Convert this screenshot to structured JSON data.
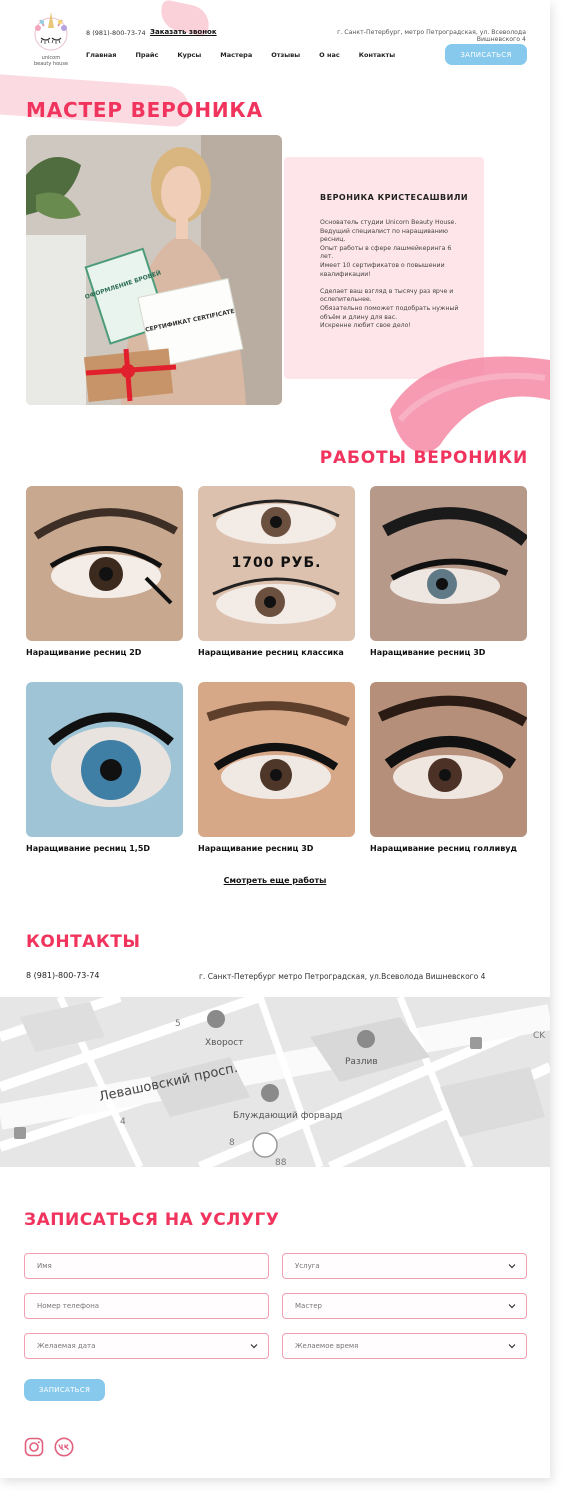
{
  "header": {
    "logo_text": "unicorn beauty house",
    "phone": "8 (981)-800-73-74",
    "callback_label": "Заказать звонок",
    "address": "г. Санкт-Петербург, метро Петроградская, ул. Всеволода Вишневского 4",
    "nav": [
      "Главная",
      "Прайс",
      "Курсы",
      "Мастера",
      "Отзывы",
      "О нас",
      "Контакты"
    ],
    "book_button": "ЗАПИСАТЬСЯ"
  },
  "hero": {
    "title": "МАСТЕР ВЕРОНИКА",
    "name": "ВЕРОНИКА КРИСТЕСАШВИЛИ",
    "bio_1": "Основатель студии Unicorn Beauty House.",
    "bio_2": "Ведущий специалист по наращиванию ресниц.",
    "bio_3": "Опыт работы в сфере лашмейкеринга 6 лет.",
    "bio_4": "Имеет 10 сертификатов о повышении квалификации!",
    "bio_5": "Сделает ваш взгляд в тысячу раз ярче и ослепительнее.",
    "bio_6": "Обязательно поможет подобрать нужный объём и длину для вас.",
    "bio_7": "Искренне любит свое дело!",
    "photo_text_1": "ОФОРМЛЕНИЕ БРОВЕЙ",
    "photo_text_2": "СЕРТИФИКАТ CERTIFICATE"
  },
  "works": {
    "title": "РАБОТЫ ВЕРОНИКИ",
    "price_overlay": "1700 РУБ.",
    "items": [
      {
        "label": "Наращивание ресниц 2D"
      },
      {
        "label": "Наращивание ресниц классика"
      },
      {
        "label": "Наращивание ресниц 3D"
      },
      {
        "label": "Наращивание ресниц 1,5D"
      },
      {
        "label": "Наращивание ресниц 3D"
      },
      {
        "label": "Наращивание ресниц голливуд"
      }
    ],
    "more_link": "Смотреть еще работы"
  },
  "contacts": {
    "title": "КОНТАКТЫ",
    "phone": "8 (981)-800-73-74",
    "address": "г. Санкт-Петербург метро Петроградская, ул.Всеволода Вишневского 4"
  },
  "map": {
    "street": "Левашовский просп.",
    "places": [
      "Хворост",
      "Разлив",
      "Блуждающий форвард"
    ],
    "numbers": [
      "5",
      "4",
      "8",
      "88",
      "CK"
    ]
  },
  "form": {
    "title": "ЗАПИСАТЬСЯ НА УСЛУГУ",
    "name_placeholder": "Имя",
    "service_placeholder": "Услуга",
    "phone_placeholder": "Номер телефона",
    "master_placeholder": "Мастер",
    "date_placeholder": "Желаемая дата",
    "time_placeholder": "Желаемое время",
    "submit": "ЗАПИСАТЬСЯ"
  },
  "social": {
    "icons": [
      "instagram-icon",
      "vk-icon"
    ]
  },
  "colors": {
    "accent": "#f0345d",
    "button": "#86c9ec",
    "card": "#fde5ea",
    "field_border": "#f0a0b2"
  }
}
